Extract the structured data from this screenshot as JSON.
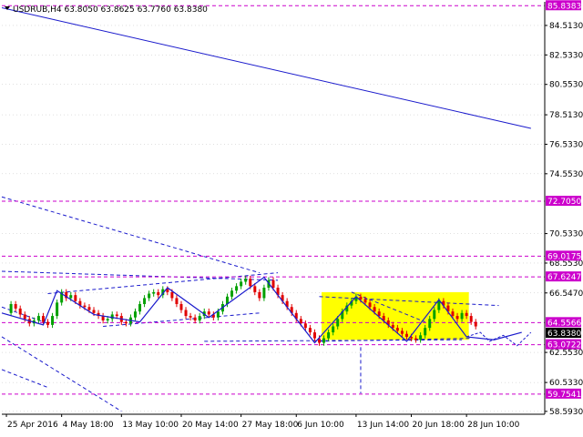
{
  "header": {
    "symbol_line": "USDRUB,H4  63.8050 63.8625 63.7760 63.8380",
    "menu_icon": "triangle-down-icon"
  },
  "colors": {
    "background": "#ffffff",
    "axis": "#000000",
    "grid": "#c0c0c0",
    "bull": "#00a000",
    "bear": "#e00000",
    "line": "#1a1acc",
    "level": "#cc00cc",
    "label_bg": "#cc00cc",
    "current_label_bg": "#000000",
    "rect": "#ffff00"
  },
  "chart_data": {
    "type": "candlestick",
    "symbol": "USDRUB",
    "timeframe": "H4",
    "ohlc_last": {
      "open": 63.805,
      "high": 63.8625,
      "low": 63.776,
      "close": 63.838
    },
    "y_range": [
      58.4,
      86.1
    ],
    "x_range": [
      0,
      118
    ],
    "y_ticks": [
      {
        "value": 84.513,
        "label": "84.5130"
      },
      {
        "value": 82.533,
        "label": "82.5330"
      },
      {
        "value": 80.553,
        "label": "80.5530"
      },
      {
        "value": 78.513,
        "label": "78.5130"
      },
      {
        "value": 76.533,
        "label": "76.5330"
      },
      {
        "value": 74.553,
        "label": "74.5530"
      },
      {
        "value": 70.533,
        "label": "70.5330"
      },
      {
        "value": 68.553,
        "label": "68.5530"
      },
      {
        "value": 66.547,
        "label": "66.5470"
      },
      {
        "value": 62.553,
        "label": "62.5530"
      },
      {
        "value": 60.533,
        "label": "60.5330"
      },
      {
        "value": 58.593,
        "label": "58.5930"
      }
    ],
    "x_ticks": [
      {
        "x": 1,
        "label": "25 Apr 2016"
      },
      {
        "x": 13,
        "label": "4 May 18:00"
      },
      {
        "x": 26,
        "label": "13 May 10:00"
      },
      {
        "x": 39,
        "label": "20 May 14:00"
      },
      {
        "x": 52,
        "label": "27 May 18:00"
      },
      {
        "x": 64,
        "label": "6 Jun 10:00"
      },
      {
        "x": 77,
        "label": "13 Jun 14:00"
      },
      {
        "x": 89,
        "label": "20 Jun 18:00"
      },
      {
        "x": 101,
        "label": "28 Jun 10:00"
      }
    ],
    "levels": [
      {
        "value": 85.8383,
        "label": "85.8383"
      },
      {
        "value": 72.705,
        "label": "72.7050"
      },
      {
        "value": 69.0175,
        "label": "69.0175"
      },
      {
        "value": 67.6247,
        "label": "67.6247"
      },
      {
        "value": 64.5566,
        "label": "64.5566"
      },
      {
        "value": 63.0722,
        "label": "63.0722"
      },
      {
        "value": 59.7541,
        "label": "59.7541"
      }
    ],
    "current": {
      "value": 63.838,
      "label": "63.8380"
    },
    "rectangle": {
      "x0": 69.5,
      "x1": 101.5,
      "y0": 63.4,
      "y1": 66.6
    },
    "trendlines": [
      {
        "x": [
          0,
          115
        ],
        "y": [
          85.7,
          77.6
        ]
      },
      {
        "x": [
          0,
          56
        ],
        "y": [
          73.0,
          67.9
        ]
      },
      {
        "x": [
          0,
          26
        ],
        "y": [
          63.6,
          58.6
        ]
      },
      {
        "x": [
          0,
          10
        ],
        "y": [
          61.4,
          60.2
        ]
      },
      {
        "x": [
          0,
          60
        ],
        "y": [
          68.0,
          67.4
        ]
      },
      {
        "x": [
          0,
          10
        ],
        "y": [
          65.6,
          64.5
        ]
      },
      {
        "x": [
          10,
          60
        ],
        "y": [
          66.5,
          67.9
        ]
      },
      {
        "x": [
          22,
          56
        ],
        "y": [
          64.3,
          65.2
        ]
      },
      {
        "x": [
          44,
          100
        ],
        "y": [
          63.3,
          63.4
        ]
      },
      {
        "x": [
          69,
          108
        ],
        "y": [
          66.3,
          65.7
        ]
      },
      {
        "x": [
          69,
          102
        ],
        "y": [
          63.3,
          63.5
        ]
      },
      {
        "x": [
          76,
          92
        ],
        "y": [
          66.6,
          64.6
        ]
      },
      {
        "x": [
          78,
          78
        ],
        "y": [
          62.9,
          59.8
        ]
      }
    ],
    "zigzag": {
      "x": [
        0,
        9,
        12,
        20,
        30,
        36,
        45,
        57,
        68,
        77,
        88,
        95,
        101,
        107,
        113
      ],
      "y": [
        65.2,
        64.4,
        66.7,
        65.1,
        64.6,
        66.9,
        64.9,
        67.6,
        63.2,
        66.3,
        63.3,
        66.1,
        63.6,
        63.4,
        63.9
      ]
    },
    "zigzag_projection": {
      "x": [
        101,
        104,
        106,
        109,
        112,
        115
      ],
      "y": [
        63.6,
        63.9,
        63.3,
        63.7,
        63.0,
        63.9
      ]
    },
    "candles": {
      "o": [
        65.2,
        65.8,
        65.5,
        65.1,
        64.8,
        64.5,
        64.7,
        65.0,
        64.6,
        64.4,
        65.0,
        65.9,
        66.6,
        66.2,
        66.4,
        66.0,
        65.7,
        65.6,
        65.4,
        65.2,
        65.0,
        64.7,
        64.8,
        65.1,
        65.0,
        64.6,
        64.5,
        64.9,
        65.3,
        65.8,
        66.2,
        66.5,
        66.6,
        66.4,
        66.8,
        66.6,
        66.2,
        65.8,
        65.4,
        65.0,
        64.9,
        64.7,
        65.0,
        65.3,
        65.1,
        64.9,
        65.3,
        65.8,
        66.3,
        66.7,
        67.0,
        67.3,
        67.5,
        67.0,
        66.6,
        66.2,
        66.9,
        67.4,
        66.9,
        66.4,
        66.0,
        65.6,
        65.2,
        64.8,
        64.5,
        64.2,
        63.9,
        63.5,
        63.2,
        63.5,
        63.9,
        64.3,
        64.8,
        65.3,
        65.7,
        66.0,
        66.3,
        66.1,
        65.9,
        65.6,
        65.3,
        65.0,
        64.7,
        64.4,
        64.2,
        64.0,
        63.8,
        63.6,
        63.5,
        63.4,
        63.7,
        64.2,
        64.8,
        65.4,
        66.0,
        65.7,
        65.3,
        65.0,
        64.8,
        65.2,
        65.0,
        64.6
      ],
      "c": [
        65.8,
        65.5,
        65.1,
        64.8,
        64.5,
        64.7,
        65.0,
        64.6,
        64.4,
        65.0,
        65.9,
        66.6,
        66.2,
        66.4,
        66.0,
        65.7,
        65.6,
        65.4,
        65.2,
        65.0,
        64.7,
        64.8,
        65.1,
        65.0,
        64.6,
        64.5,
        64.9,
        65.3,
        65.8,
        66.2,
        66.5,
        66.6,
        66.4,
        66.8,
        66.6,
        66.2,
        65.8,
        65.4,
        65.0,
        64.9,
        64.7,
        65.0,
        65.3,
        65.1,
        64.9,
        65.3,
        65.8,
        66.3,
        66.7,
        67.0,
        67.3,
        67.5,
        67.0,
        66.6,
        66.2,
        66.9,
        67.4,
        66.9,
        66.4,
        66.0,
        65.6,
        65.2,
        64.8,
        64.5,
        64.2,
        63.9,
        63.5,
        63.2,
        63.5,
        63.9,
        64.3,
        64.8,
        65.3,
        65.7,
        66.0,
        66.3,
        66.1,
        65.9,
        65.6,
        65.3,
        65.0,
        64.7,
        64.4,
        64.2,
        64.0,
        63.8,
        63.6,
        63.5,
        63.4,
        63.7,
        64.2,
        64.8,
        65.4,
        66.0,
        65.7,
        65.3,
        65.0,
        64.8,
        65.2,
        65.0,
        64.6,
        64.3
      ],
      "h": [
        66.0,
        66.0,
        65.7,
        65.3,
        65.0,
        64.9,
        65.2,
        65.2,
        64.8,
        65.2,
        66.1,
        66.8,
        66.8,
        66.6,
        66.6,
        66.2,
        65.9,
        65.8,
        65.6,
        65.4,
        65.2,
        65.0,
        65.3,
        65.3,
        65.2,
        64.8,
        65.1,
        65.5,
        66.0,
        66.4,
        66.7,
        66.8,
        66.8,
        67.0,
        67.0,
        66.8,
        66.4,
        66.0,
        65.6,
        65.2,
        65.1,
        65.2,
        65.5,
        65.5,
        65.3,
        65.5,
        66.0,
        66.5,
        66.9,
        67.2,
        67.5,
        67.7,
        67.7,
        67.2,
        66.8,
        67.1,
        67.6,
        67.6,
        67.1,
        66.6,
        66.2,
        65.8,
        65.4,
        65.0,
        64.7,
        64.4,
        64.1,
        63.7,
        63.7,
        64.1,
        64.5,
        65.0,
        65.5,
        65.9,
        66.2,
        66.5,
        66.5,
        66.3,
        66.1,
        65.8,
        65.5,
        65.2,
        64.9,
        64.6,
        64.4,
        64.2,
        64.0,
        63.8,
        63.7,
        63.9,
        64.4,
        65.0,
        65.6,
        66.2,
        66.2,
        65.9,
        65.5,
        65.2,
        65.4,
        65.4,
        65.2,
        64.8
      ],
      "l": [
        65.0,
        65.3,
        64.9,
        64.6,
        64.3,
        64.3,
        64.5,
        64.4,
        64.2,
        64.2,
        64.8,
        65.7,
        66.0,
        66.0,
        65.8,
        65.5,
        65.4,
        65.2,
        65.0,
        64.8,
        64.5,
        64.5,
        64.6,
        64.8,
        64.4,
        64.3,
        64.3,
        64.7,
        65.1,
        65.6,
        66.0,
        66.3,
        66.2,
        66.2,
        66.4,
        66.0,
        65.6,
        65.2,
        64.8,
        64.7,
        64.5,
        64.5,
        64.8,
        64.9,
        64.7,
        64.7,
        65.1,
        65.6,
        66.1,
        66.5,
        66.8,
        67.1,
        66.8,
        66.4,
        66.0,
        66.0,
        66.7,
        66.7,
        66.2,
        65.8,
        65.4,
        65.0,
        64.6,
        64.3,
        64.0,
        63.7,
        63.3,
        63.0,
        63.0,
        63.3,
        63.7,
        64.1,
        64.6,
        65.1,
        65.5,
        65.8,
        65.9,
        65.7,
        65.4,
        65.1,
        64.8,
        64.5,
        64.2,
        64.0,
        63.8,
        63.6,
        63.4,
        63.3,
        63.2,
        63.2,
        63.5,
        64.0,
        64.6,
        65.2,
        65.5,
        65.1,
        64.8,
        64.6,
        64.6,
        64.8,
        64.4,
        64.1
      ]
    }
  }
}
